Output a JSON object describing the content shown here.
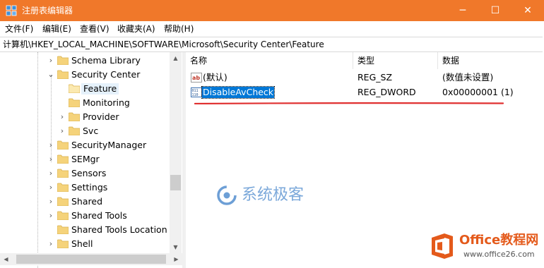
{
  "window": {
    "title": "注册表编辑器",
    "minimize_glyph": "─",
    "maximize_glyph": "☐",
    "close_glyph": "✕"
  },
  "menu": [
    "文件(F)",
    "编辑(E)",
    "查看(V)",
    "收藏夹(A)",
    "帮助(H)"
  ],
  "address": "计算机\\HKEY_LOCAL_MACHINE\\SOFTWARE\\Microsoft\\Security Center\\Feature",
  "tree": {
    "items": [
      {
        "label": "Schema Library",
        "expander": "›",
        "icon": "folder-icon"
      },
      {
        "label": "Security Center",
        "expander": "⌄",
        "icon": "folder-open-icon"
      },
      {
        "label": "Feature",
        "expander": "",
        "icon": "folder-open-icon",
        "selected": true
      },
      {
        "label": "Monitoring",
        "expander": "",
        "icon": "folder-icon"
      },
      {
        "label": "Provider",
        "expander": "›",
        "icon": "folder-icon"
      },
      {
        "label": "Svc",
        "expander": "›",
        "icon": "folder-icon"
      },
      {
        "label": "SecurityManager",
        "expander": "›",
        "icon": "folder-icon"
      },
      {
        "label": "SEMgr",
        "expander": "›",
        "icon": "folder-icon"
      },
      {
        "label": "Sensors",
        "expander": "›",
        "icon": "folder-icon"
      },
      {
        "label": "Settings",
        "expander": "›",
        "icon": "folder-icon"
      },
      {
        "label": "Shared",
        "expander": "›",
        "icon": "folder-icon"
      },
      {
        "label": "Shared Tools",
        "expander": "›",
        "icon": "folder-icon"
      },
      {
        "label": "Shared Tools Location",
        "expander": "",
        "icon": "folder-icon"
      },
      {
        "label": "Shell",
        "expander": "›",
        "icon": "folder-icon"
      }
    ]
  },
  "list": {
    "columns": [
      "名称",
      "类型",
      "数据"
    ],
    "rows": [
      {
        "name": "(默认)",
        "type": "REG_SZ",
        "data": "(数值未设置)",
        "icon": "string-value-icon"
      },
      {
        "name": "DisableAvCheck",
        "type": "REG_DWORD",
        "data": "0x00000001 (1)",
        "icon": "dword-value-icon",
        "selected": true
      }
    ]
  },
  "watermark": {
    "text": "系统极客"
  },
  "badge": {
    "title": "Office教程网",
    "url": "www.office26.com"
  },
  "colors": {
    "titlebar": "#f0782a",
    "selection": "#0078d7",
    "annotation": "#e03030"
  }
}
